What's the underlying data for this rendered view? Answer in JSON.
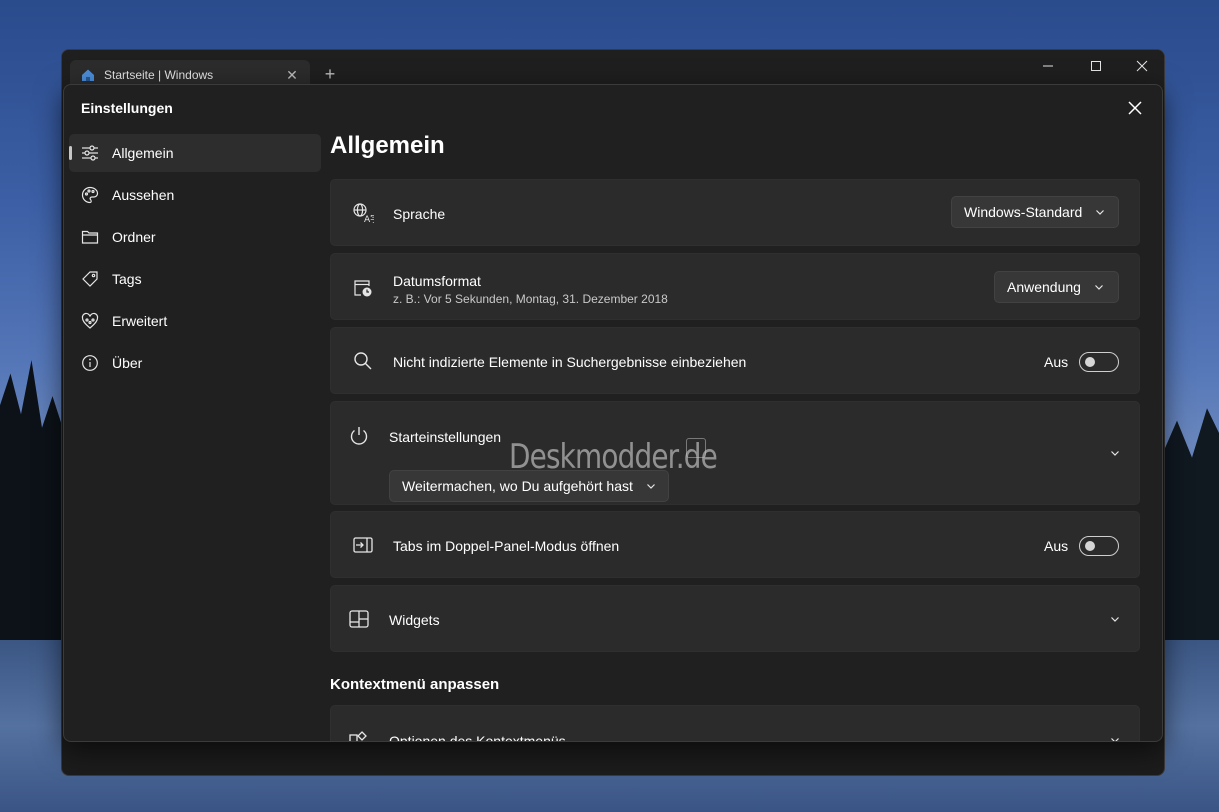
{
  "tab": {
    "title": "Startseite | Windows",
    "close": "✕",
    "new_tab": "+"
  },
  "window_controls": {
    "minimize": "—",
    "maximize": "☐",
    "close": "✕"
  },
  "dialog": {
    "title": "Einstellungen"
  },
  "sidebar": {
    "items": [
      {
        "label": "Allgemein",
        "icon": "sliders-icon",
        "active": true
      },
      {
        "label": "Aussehen",
        "icon": "palette-icon"
      },
      {
        "label": "Ordner",
        "icon": "folder-icon"
      },
      {
        "label": "Tags",
        "icon": "tag-icon"
      },
      {
        "label": "Erweitert",
        "icon": "advanced-icon"
      },
      {
        "label": "Über",
        "icon": "info-icon"
      }
    ]
  },
  "main": {
    "title": "Allgemein",
    "language": {
      "label": "Sprache",
      "value": "Windows-Standard"
    },
    "date_format": {
      "label": "Datumsformat",
      "example": "z. B.: Vor 5 Sekunden, Montag, 31. Dezember 2018",
      "value": "Anwendung"
    },
    "unindexed": {
      "label": "Nicht indizierte Elemente in Suchergebnisse einbeziehen",
      "state": "Aus"
    },
    "startup": {
      "label": "Starteinstellungen",
      "value": "Weitermachen, wo Du aufgehört hast"
    },
    "dual_pane": {
      "label": "Tabs im Doppel-Panel-Modus öffnen",
      "state": "Aus"
    },
    "widgets": {
      "label": "Widgets"
    },
    "context_section": "Kontextmenü anpassen",
    "context_options": {
      "label": "Optionen des Kontextmenüs"
    }
  },
  "watermark": "Deskmodder.de",
  "colors": {
    "card": "#2b2b2b",
    "dialog": "#202020",
    "accent_text": "#ffffff"
  }
}
